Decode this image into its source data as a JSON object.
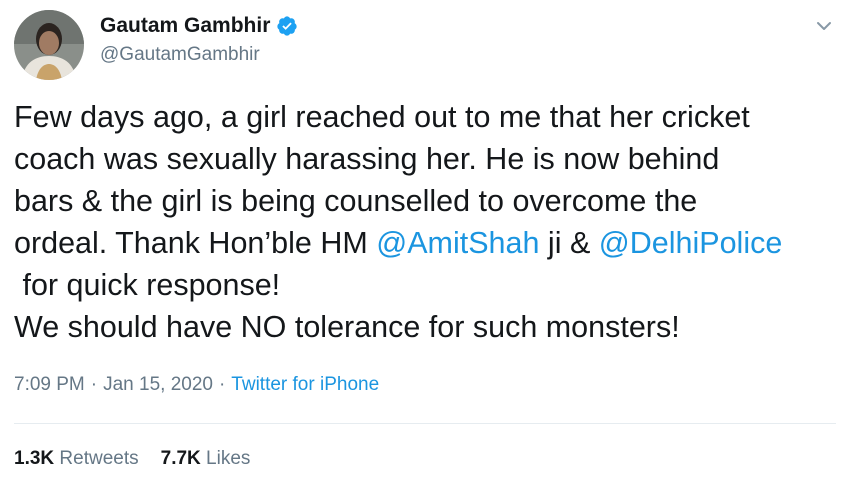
{
  "author": {
    "name": "Gautam Gambhir",
    "handle": "@GautamGambhir",
    "verified_color": "#1da1f2"
  },
  "icons": {
    "avatar": "profile-photo",
    "verified": "verified-badge-icon",
    "menu": "chevron-down-icon"
  },
  "tweet": {
    "line1": "Few days ago, a girl reached out to me that her cricket",
    "line2": "coach was sexually harassing her. He is now behind",
    "line3": "bars & the girl is being counselled to overcome the",
    "line4_pre": "ordeal. Thank Hon’ble HM ",
    "mention1": "@AmitShah",
    "line4_mid": " ji & ",
    "mention2": "@DelhiPolice",
    "line5": " for quick response!",
    "line6": "We should have NO tolerance for such monsters!"
  },
  "meta": {
    "time": "7:09 PM",
    "separator": "·",
    "date": "Jan 15, 2020",
    "source": "Twitter for iPhone"
  },
  "stats": {
    "retweets_count": "1.3K",
    "retweets_label": "Retweets",
    "likes_count": "7.7K",
    "likes_label": "Likes"
  },
  "colors": {
    "link": "#1b95e0",
    "secondary_text": "#657786",
    "primary_text": "#14171a"
  }
}
